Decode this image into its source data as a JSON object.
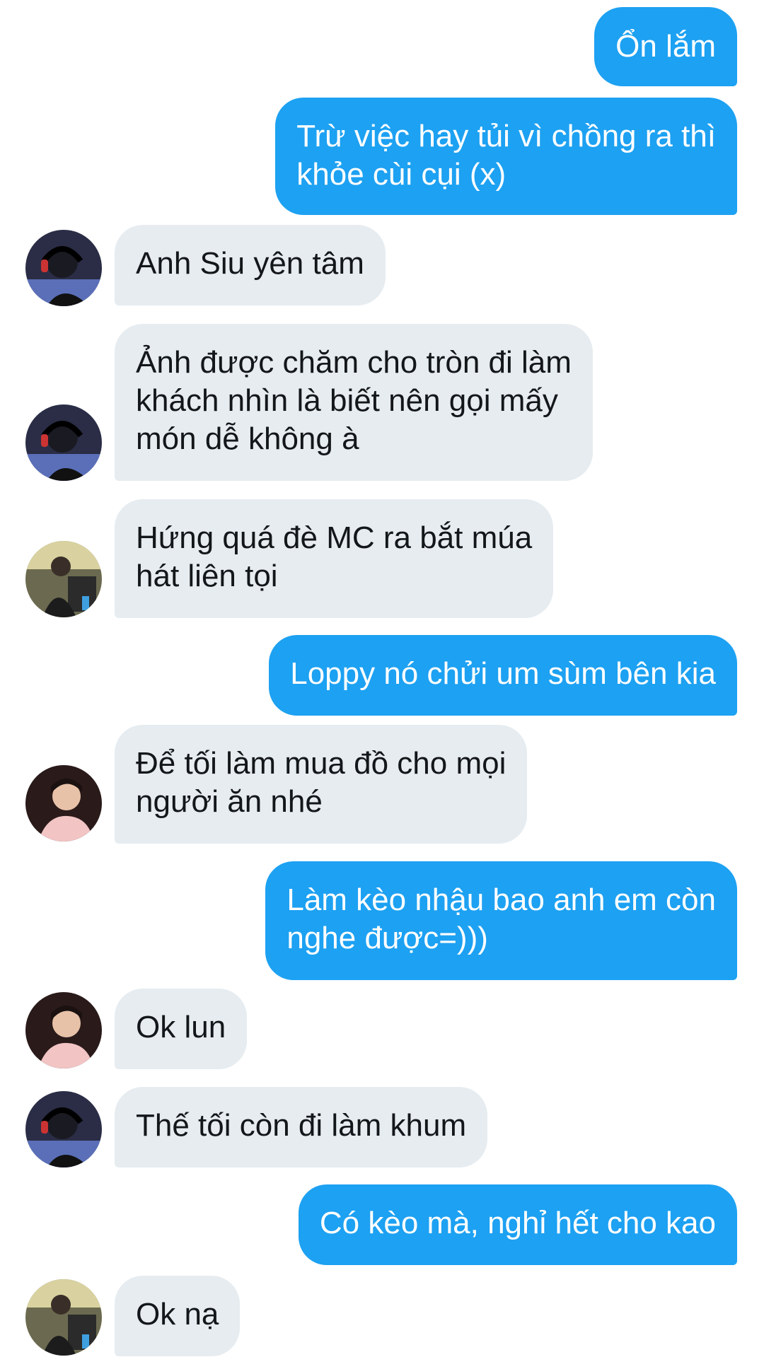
{
  "messages": [
    {
      "side": "out",
      "text": "Ổn lắm"
    },
    {
      "side": "out",
      "lines": [
        "Trừ việc hay tủi vì chồng ra thì",
        "khỏe cùi cụi (x)"
      ]
    },
    {
      "side": "in",
      "avatar": "avatar-headset-icon",
      "text": "Anh Siu yên tâm"
    },
    {
      "side": "in",
      "avatar": "avatar-headset-icon",
      "lines": [
        "Ảnh được chăm cho tròn đi làm",
        "khách nhìn là biết nên gọi mấy",
        "món dễ không à"
      ]
    },
    {
      "side": "in",
      "avatar": "avatar-gym-icon",
      "lines": [
        "Hứng quá đè MC ra bắt múa",
        "hát liên tọi"
      ]
    },
    {
      "side": "out",
      "text": "Loppy nó chửi um sùm bên kia"
    },
    {
      "side": "in",
      "avatar": "avatar-pink-jacket-icon",
      "lines": [
        "Để tối làm mua đồ cho mọi",
        "người ăn nhé"
      ]
    },
    {
      "side": "out",
      "lines": [
        "Làm kèo nhậu bao anh em còn",
        "nghe được=)))"
      ]
    },
    {
      "side": "in",
      "avatar": "avatar-pink-jacket-icon",
      "text": "Ok lun"
    },
    {
      "side": "in",
      "avatar": "avatar-headset-icon",
      "text": "Thế tối còn đi làm khum"
    },
    {
      "side": "out",
      "text": "Có kèo mà, nghỉ hết cho kao"
    },
    {
      "side": "in",
      "avatar": "avatar-gym-icon",
      "text": "Ok nạ"
    }
  ],
  "colors": {
    "outgoing_bubble": "#1da1f2",
    "incoming_bubble": "#e6ecf0",
    "outgoing_text": "#ffffff",
    "incoming_text": "#14171a"
  }
}
